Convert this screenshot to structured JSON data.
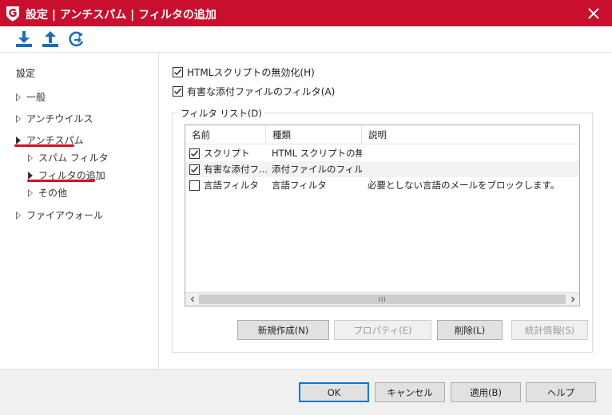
{
  "window": {
    "title": "設定 | アンチスパム | フィルタの追加",
    "close_icon": "close-icon",
    "accent_color": "#c8102e"
  },
  "toolbar": {
    "buttons": [
      {
        "icon": "import-icon",
        "color": "#1f6db5"
      },
      {
        "icon": "export-icon",
        "color": "#1f6db5"
      },
      {
        "icon": "reset-icon",
        "color": "#1f6db5"
      }
    ]
  },
  "sidebar": {
    "root_label": "設定",
    "items": [
      {
        "label": "一般"
      },
      {
        "label": "アンチウイルス"
      },
      {
        "label": "アンチスパム",
        "highlight": true
      },
      {
        "label": "スパム フィルタ"
      },
      {
        "label": "フィルタの追加",
        "highlight": true
      },
      {
        "label": "その他"
      },
      {
        "label": "ファイアウォール"
      }
    ],
    "highlight_color": "#d50f25"
  },
  "options": {
    "html_script": {
      "label": "HTMLスクリプトの無効化(H)",
      "checked": true
    },
    "attachment": {
      "label": "有害な添付ファイルのフィルタ(A)",
      "checked": true
    }
  },
  "filter_list": {
    "group_label": "フィルタ リスト(D)",
    "columns": [
      "名前",
      "種類",
      "説明"
    ],
    "rows": [
      {
        "checked": true,
        "name": "スクリプト",
        "type": "HTML スクリプトの無...",
        "description": ""
      },
      {
        "checked": true,
        "name": "有害な添付フ...",
        "type": "添付ファイルのフィルタ",
        "description": ""
      },
      {
        "checked": false,
        "name": "言語フィルタ",
        "type": "言語フィルタ",
        "description": "必要としない言語のメールをブロックします。"
      }
    ],
    "scrollbar_grip": "III"
  },
  "list_buttons": {
    "new": "新規作成(N)",
    "properties": "プロパティ(E)",
    "delete": "削除(L)",
    "statistics": "統計情報(S)"
  },
  "footer": {
    "ok": "OK",
    "cancel": "キャンセル",
    "apply": "適用(B)",
    "help": "ヘルプ"
  }
}
